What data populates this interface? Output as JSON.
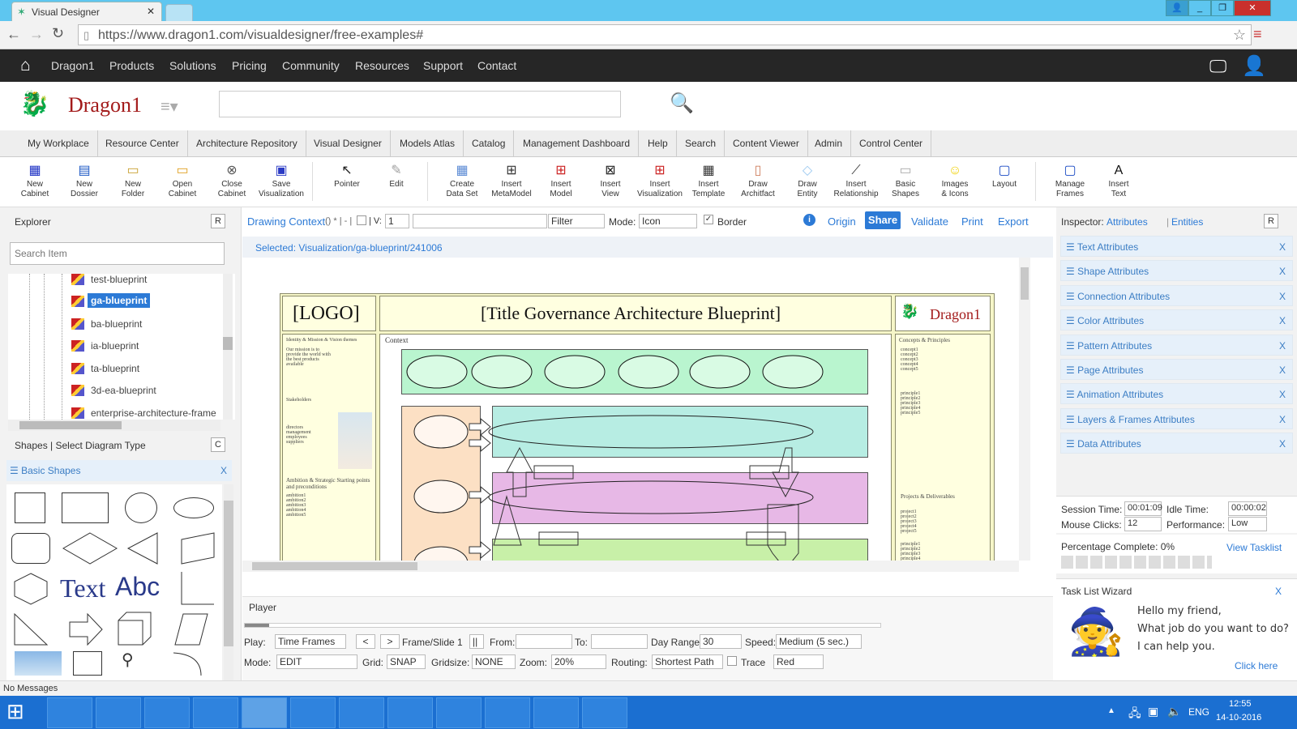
{
  "browser": {
    "tab_title": "Visual Designer",
    "url": "https://www.dragon1.com/visualdesigner/free-examples#"
  },
  "nav": {
    "items": [
      "Dragon1",
      "Products",
      "Solutions",
      "Pricing",
      "Community",
      "Resources",
      "Support",
      "Contact"
    ]
  },
  "brand": {
    "logo_text": "Dragon1"
  },
  "menu": {
    "items": [
      "My Workplace",
      "Resource Center",
      "Architecture Repository",
      "Visual Designer",
      "Models Atlas",
      "Catalog",
      "Management Dashboard",
      "Help",
      "Search",
      "Content Viewer",
      "Admin",
      "Control Center"
    ]
  },
  "toolbar": {
    "items": [
      {
        "l1": "New",
        "l2": "Cabinet",
        "icon": "cabinet-icon"
      },
      {
        "l1": "New",
        "l2": "Dossier",
        "icon": "dossier-icon"
      },
      {
        "l1": "New",
        "l2": "Folder",
        "icon": "folder-icon"
      },
      {
        "l1": "Open",
        "l2": "Cabinet",
        "icon": "open-folder-icon"
      },
      {
        "l1": "Close",
        "l2": "Cabinet",
        "icon": "close-icon"
      },
      {
        "l1": "Save",
        "l2": "Visualization",
        "icon": "save-icon"
      },
      {
        "l1": "Pointer",
        "l2": "",
        "icon": "pointer-icon"
      },
      {
        "l1": "Edit",
        "l2": "",
        "icon": "edit-icon"
      },
      {
        "l1": "Create",
        "l2": "Data Set",
        "icon": "dataset-icon"
      },
      {
        "l1": "Insert",
        "l2": "MetaModel",
        "icon": "metamodel-icon"
      },
      {
        "l1": "Insert",
        "l2": "Model",
        "icon": "model-icon"
      },
      {
        "l1": "Insert",
        "l2": "View",
        "icon": "view-icon"
      },
      {
        "l1": "Insert",
        "l2": "Visualization",
        "icon": "visualization-icon"
      },
      {
        "l1": "Insert",
        "l2": "Template",
        "icon": "template-icon"
      },
      {
        "l1": "Draw",
        "l2": "Architfact",
        "icon": "architfact-icon"
      },
      {
        "l1": "Draw",
        "l2": "Entity",
        "icon": "entity-icon"
      },
      {
        "l1": "Insert",
        "l2": "Relationship",
        "icon": "relationship-icon"
      },
      {
        "l1": "Basic",
        "l2": "Shapes",
        "icon": "shapes-icon"
      },
      {
        "l1": "Images",
        "l2": "& Icons",
        "icon": "smiley-icon"
      },
      {
        "l1": "Layout",
        "l2": "",
        "icon": "layout-icon"
      },
      {
        "l1": "Manage",
        "l2": "Frames",
        "icon": "frames-icon"
      },
      {
        "l1": "Insert",
        "l2": "Text",
        "icon": "text-icon"
      }
    ]
  },
  "explorer": {
    "title": "Explorer",
    "badge": "R",
    "search_placeholder": "Search Item",
    "items": [
      "test-blueprint",
      "ga-blueprint",
      "ba-blueprint",
      "ia-blueprint",
      "ta-blueprint",
      "3d-ea-blueprint",
      "enterprise-architecture-frame"
    ]
  },
  "shapes": {
    "title": "Shapes | Select Diagram Type",
    "badge": "C",
    "group": "Basic Shapes",
    "close": "X",
    "text1": "Text",
    "text2": "Abc"
  },
  "drawing": {
    "context": "Drawing Context",
    "ctx_suffix": "() * | - |",
    "v_label": "| V:",
    "v_value": "1",
    "filter": "Filter",
    "mode_label": "Mode:",
    "mode_value": "Icon",
    "border_label": "Border",
    "origin": "Origin",
    "share": "Share",
    "validate": "Validate",
    "print": "Print",
    "export": "Export",
    "selected": "Selected: Visualization/ga-blueprint/241006"
  },
  "blueprint": {
    "logo": "[LOGO]",
    "title": "[Title Governance Architecture Blueprint]",
    "brand": "Dragon1",
    "context": "Context",
    "identity": "Identity & Mission & Vision themes",
    "mission": "Our mission is to provide the world with the best products available",
    "stakeholders": "Stakeholders",
    "stake_items": [
      "directors",
      "management",
      "employees",
      "suppliers"
    ],
    "ambition": "Ambition & Strategic Starting points and preconditions",
    "ambitions": [
      "ambition1",
      "ambition2",
      "ambition3",
      "ambition4",
      "ambition5"
    ],
    "concepts": "Concepts & Principles",
    "concept_items": [
      "concept1",
      "concept2",
      "concept3",
      "concept4",
      "concept5"
    ],
    "principle_items": [
      "principle1",
      "principle2",
      "principle3",
      "principle4",
      "principle5"
    ],
    "projects": "Projects & Deliverables",
    "project_items": [
      "project1",
      "project2",
      "project3",
      "project4",
      "project5"
    ],
    "deliverable_items": [
      "principle1",
      "principle2",
      "principle3",
      "principle4",
      "principle5"
    ]
  },
  "player": {
    "title": "Player",
    "play_label": "Play:",
    "play_value": "Time Frames",
    "prev": "<",
    "next": ">",
    "frame": "Frame/Slide 1",
    "pause": "||",
    "from": "From:",
    "to": "To:",
    "day_range": "Day Range:",
    "day_value": "30",
    "speed": "Speed:",
    "speed_value": "Medium (5 sec.)",
    "mode": "Mode:",
    "mode_value": "EDIT",
    "grid": "Grid:",
    "grid_value": "SNAP",
    "gridsize": "Gridsize:",
    "gridsize_value": "NONE",
    "zoom": "Zoom:",
    "zoom_value": "20%",
    "routing": "Routing:",
    "routing_value": "Shortest Path",
    "trace": "Trace",
    "color_value": "Red"
  },
  "inspector": {
    "title": "Inspector:",
    "attributes": "Attributes",
    "entities": "Entities",
    "badge": "R",
    "items": [
      "Text Attributes",
      "Shape Attributes",
      "Connection Attributes",
      "Color Attributes",
      "Pattern Attributes",
      "Page Attributes",
      "Animation Attributes",
      "Layers & Frames Attributes",
      "Data Attributes"
    ]
  },
  "session": {
    "time_label": "Session Time:",
    "time": "00:01:09",
    "idle_label": "Idle Time:",
    "idle": "00:00:02",
    "clicks_label": "Mouse Clicks:",
    "clicks": "12",
    "perf_label": "Performance:",
    "perf": "Low",
    "pct": "Percentage Complete: 0%",
    "tasklist": "View Tasklist"
  },
  "wizard": {
    "title": "Task List Wizard",
    "close": "X",
    "line1": "Hello my friend,",
    "line2": "What job do you want to do?",
    "line3": "I can help you.",
    "link": "Click here"
  },
  "status": {
    "message": "No Messages"
  },
  "taskbar": {
    "lang": "ENG",
    "time": "12:55",
    "date": "14-10-2016"
  }
}
